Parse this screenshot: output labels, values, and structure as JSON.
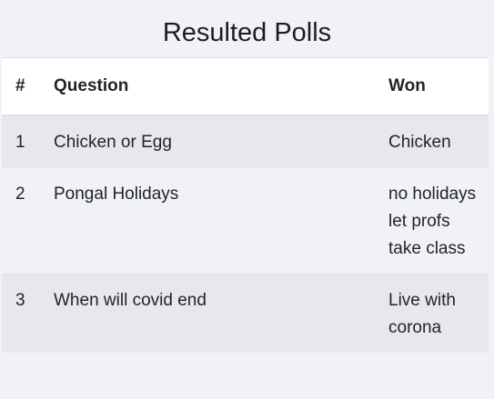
{
  "page": {
    "title": "Resulted Polls"
  },
  "table": {
    "headers": {
      "num": "#",
      "question": "Question",
      "won": "Won"
    },
    "rows": [
      {
        "num": "1",
        "question": "Chicken or Egg",
        "won": "Chicken"
      },
      {
        "num": "2",
        "question": "Pongal Holidays",
        "won": "no holidays let profs take class"
      },
      {
        "num": "3",
        "question": "When will covid end",
        "won": "Live with corona"
      }
    ]
  },
  "colors": {
    "background": "#f1f2f5",
    "header_background": "#ffffff",
    "striped_row": "#e7e8eb",
    "text": "#212529"
  }
}
